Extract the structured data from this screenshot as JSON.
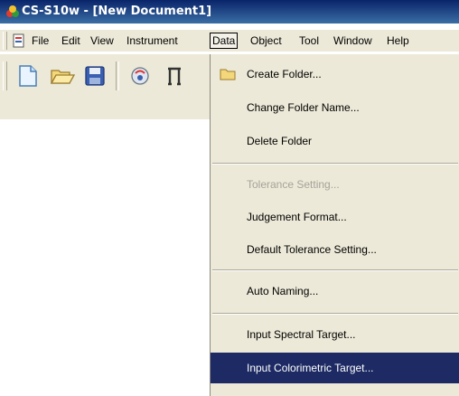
{
  "window": {
    "title": "CS-S10w - [New Document1]"
  },
  "menubar": {
    "items": [
      {
        "label": "File"
      },
      {
        "label": "Edit"
      },
      {
        "label": "View"
      },
      {
        "label": "Instrument"
      },
      {
        "label": "Data"
      },
      {
        "label": "Object"
      },
      {
        "label": "Tool"
      },
      {
        "label": "Window"
      },
      {
        "label": "Help"
      }
    ],
    "active": "Data"
  },
  "toolbar": {
    "icons": [
      "new-document-icon",
      "open-folder-icon",
      "save-icon",
      "instrument-icon",
      "tool-icon"
    ]
  },
  "data_menu": {
    "items": [
      {
        "label": "Create Folder...",
        "icon": "folder-icon"
      },
      {
        "label": "Change Folder Name..."
      },
      {
        "label": "Delete Folder"
      },
      {
        "label": "Tolerance Setting...",
        "disabled": true
      },
      {
        "label": "Judgement Format..."
      },
      {
        "label": "Default Tolerance Setting..."
      },
      {
        "label": "Auto Naming..."
      },
      {
        "label": "Input Spectral Target..."
      },
      {
        "label": "Input Colorimetric Target...",
        "highlighted": true
      }
    ]
  },
  "colors": {
    "title_bar": "#0a246a",
    "menu_bg": "#ece9d8",
    "highlight": "#1d2a63"
  }
}
